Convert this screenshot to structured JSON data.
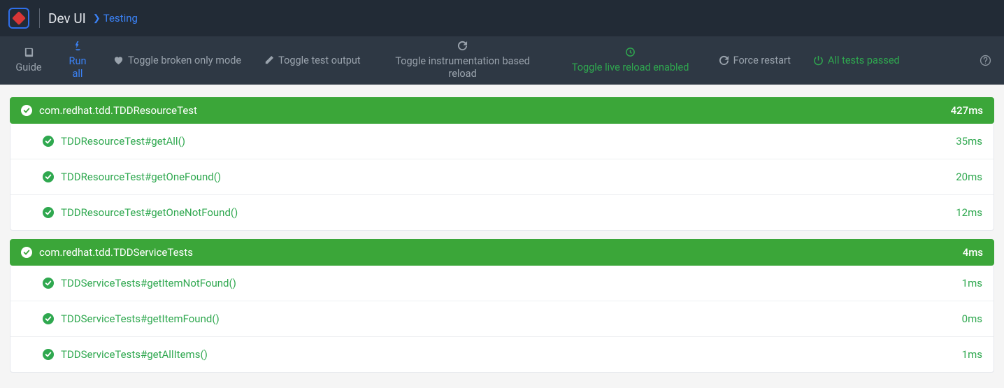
{
  "header": {
    "app_title": "Dev UI",
    "breadcrumb": "Testing"
  },
  "toolbar": {
    "guide": "Guide",
    "run_all": "Run all",
    "toggle_broken": "Toggle broken only mode",
    "toggle_output": "Toggle test output",
    "toggle_instrumentation": "Toggle instrumentation based reload",
    "toggle_live_reload": "Toggle live reload enabled",
    "force_restart": "Force restart",
    "all_passed": "All tests passed"
  },
  "suites": [
    {
      "name": "com.redhat.tdd.TDDResourceTest",
      "time": "427ms",
      "tests": [
        {
          "name": "TDDResourceTest#getAll()",
          "time": "35ms"
        },
        {
          "name": "TDDResourceTest#getOneFound()",
          "time": "20ms"
        },
        {
          "name": "TDDResourceTest#getOneNotFound()",
          "time": "12ms"
        }
      ]
    },
    {
      "name": "com.redhat.tdd.TDDServiceTests",
      "time": "4ms",
      "tests": [
        {
          "name": "TDDServiceTests#getItemNotFound()",
          "time": "1ms"
        },
        {
          "name": "TDDServiceTests#getItemFound()",
          "time": "0ms"
        },
        {
          "name": "TDDServiceTests#getAllItems()",
          "time": "1ms"
        }
      ]
    }
  ]
}
